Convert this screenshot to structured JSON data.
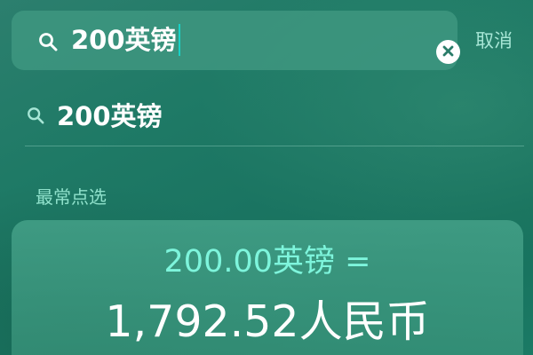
{
  "search": {
    "query": "200英镑",
    "cancel_label": "取消"
  },
  "suggestions": [
    {
      "text": "200英镑"
    }
  ],
  "sections": {
    "top_hits_title": "最常点选"
  },
  "result": {
    "from": "200.00英镑 =",
    "to": "1,792.52人民币"
  },
  "colors": {
    "accent_cursor": "#19d3c7",
    "conversion_from_text": "#7ef5dc",
    "cancel_text": "#a7e6d6",
    "section_title_text": "#8fe1cb"
  },
  "icons": {
    "search": "magnifying-glass",
    "clear": "x-circle"
  }
}
